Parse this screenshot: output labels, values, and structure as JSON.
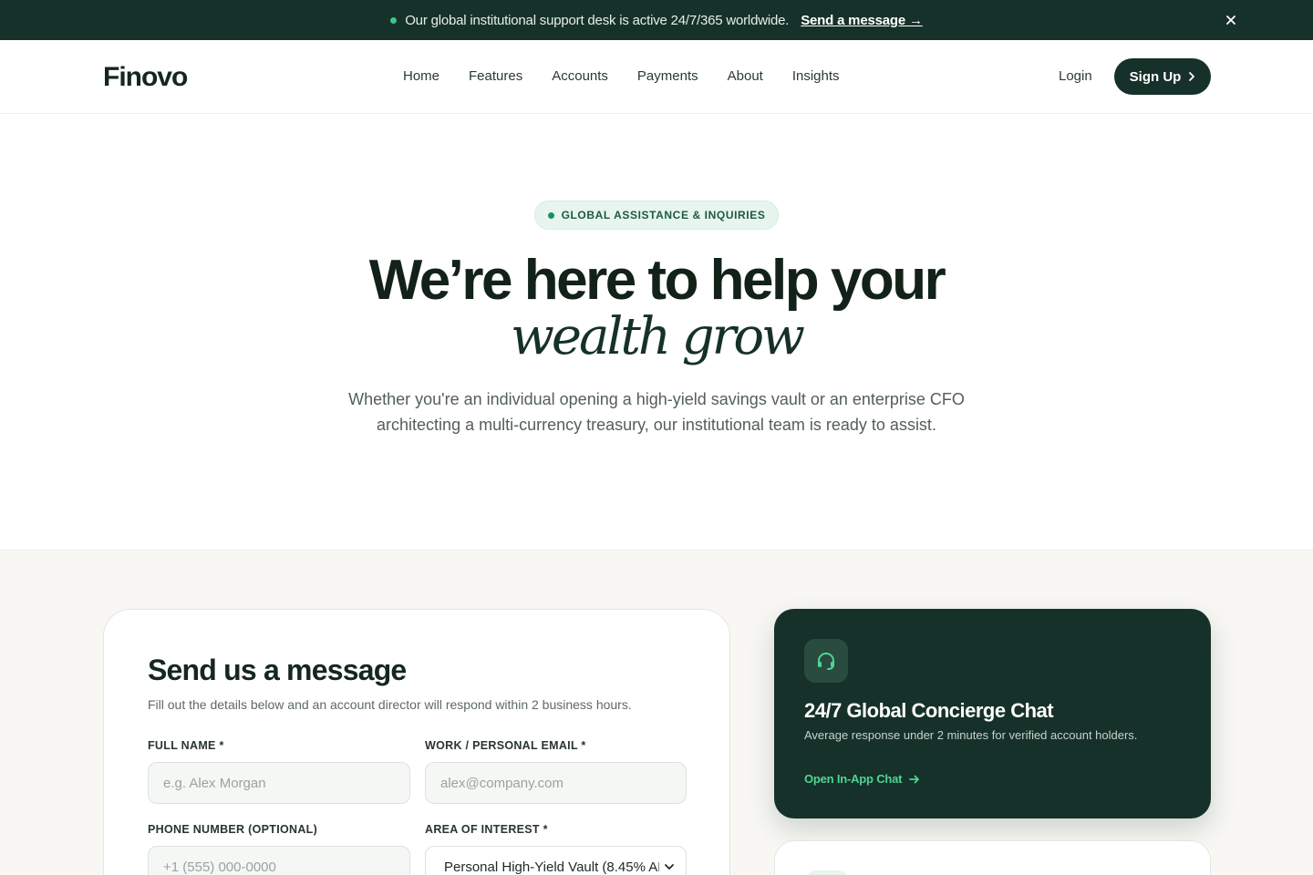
{
  "announcement": {
    "text": "Our global institutional support desk is active 24/7/365 worldwide.",
    "link": "Send a message →",
    "close": "×"
  },
  "header": {
    "logo": "Finovo",
    "nav": [
      "Home",
      "Features",
      "Accounts",
      "Payments",
      "About",
      "Insights"
    ],
    "login": "Login",
    "signup": "Sign Up"
  },
  "hero": {
    "badge": "GLOBAL ASSISTANCE & INQUIRIES",
    "title": "We’re here to help your",
    "title_script": "wealth grow",
    "subtitle": "Whether you're an individual opening a high-yield savings vault or an enterprise CFO architecting a multi-currency treasury, our institutional team is ready to assist."
  },
  "form": {
    "title": "Send us a message",
    "description": "Fill out the details below and an account director will respond within 2 business hours.",
    "full_name_label": "FULL NAME *",
    "full_name_placeholder": "e.g. Alex Morgan",
    "email_label": "WORK / PERSONAL EMAIL *",
    "email_placeholder": "alex@company.com",
    "phone_label": "PHONE NUMBER (OPTIONAL)",
    "phone_placeholder": "+1 (555) 000-0000",
    "interest_label": "AREA OF INTEREST *",
    "interest_value": "Personal High-Yield Vault (8.45% AF"
  },
  "chat_card": {
    "title": "24/7 Global Concierge Chat",
    "description": "Average response under 2 minutes for verified account holders.",
    "link": "Open In-App Chat"
  },
  "colors": {
    "brand_dark": "#163129",
    "accent_green": "#3cc788",
    "link_green": "#4fd494",
    "page_band": "#f8f7f4"
  },
  "icons": {
    "chat": "headset-icon",
    "signup": "chevron-right-icon",
    "chat_link": "arrow-right-icon",
    "select": "chevron-down-icon",
    "close": "close-icon"
  }
}
